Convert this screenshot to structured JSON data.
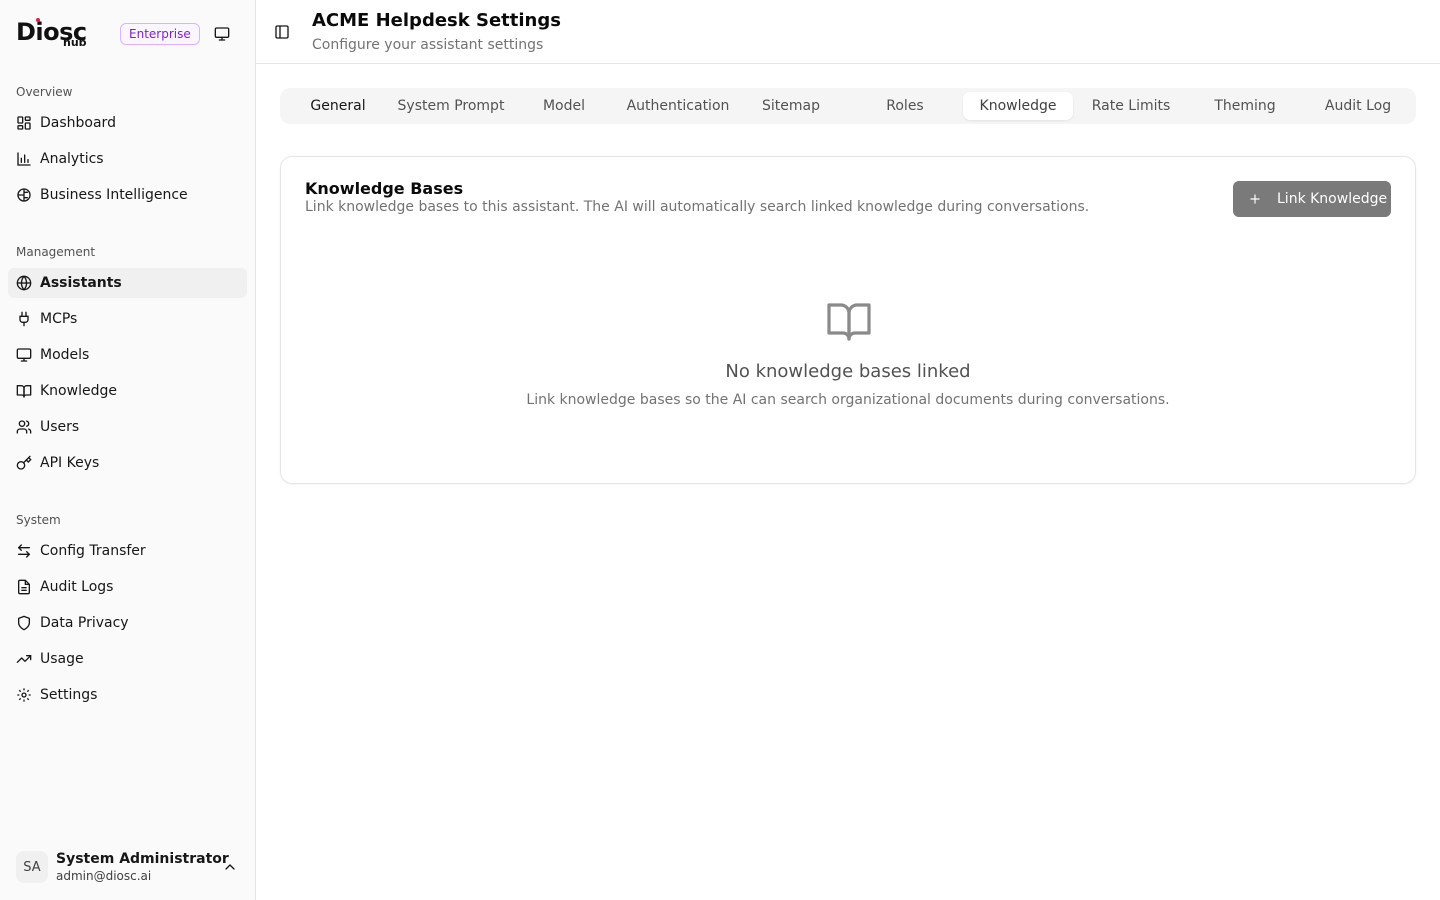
{
  "brand": {
    "logo_text": "Diosc",
    "logo_sub": "hub",
    "plan_badge": "Enterprise",
    "accent_color": "#7e22ce"
  },
  "sidebar": {
    "sections": [
      {
        "label": "Overview",
        "items": [
          {
            "label": "Dashboard",
            "icon": "dashboard-icon"
          },
          {
            "label": "Analytics",
            "icon": "bar-chart-icon"
          },
          {
            "label": "Business Intelligence",
            "icon": "brain-icon"
          }
        ]
      },
      {
        "label": "Management",
        "items": [
          {
            "label": "Assistants",
            "icon": "globe-icon",
            "active": true
          },
          {
            "label": "MCPs",
            "icon": "plug-icon"
          },
          {
            "label": "Models",
            "icon": "monitor-icon"
          },
          {
            "label": "Knowledge",
            "icon": "book-icon"
          },
          {
            "label": "Users",
            "icon": "users-icon"
          },
          {
            "label": "API Keys",
            "icon": "key-icon"
          }
        ]
      },
      {
        "label": "System",
        "items": [
          {
            "label": "Config Transfer",
            "icon": "transfer-icon"
          },
          {
            "label": "Audit Logs",
            "icon": "file-text-icon"
          },
          {
            "label": "Data Privacy",
            "icon": "shield-icon"
          },
          {
            "label": "Usage",
            "icon": "trending-icon"
          },
          {
            "label": "Settings",
            "icon": "gear-icon"
          }
        ]
      }
    ],
    "user": {
      "initials": "SA",
      "name": "System Administrator",
      "email": "admin@diosc.ai"
    }
  },
  "header": {
    "title": "ACME Helpdesk Settings",
    "subtitle": "Configure your assistant settings"
  },
  "tabs": [
    {
      "label": "General"
    },
    {
      "label": "System Prompt"
    },
    {
      "label": "Model"
    },
    {
      "label": "Authentication"
    },
    {
      "label": "Sitemap"
    },
    {
      "label": "Roles"
    },
    {
      "label": "Knowledge",
      "active": true
    },
    {
      "label": "Rate Limits"
    },
    {
      "label": "Theming"
    },
    {
      "label": "Audit Log"
    }
  ],
  "knowledge_card": {
    "title": "Knowledge Bases",
    "description": "Link knowledge bases to this assistant. The AI will automatically search linked knowledge during conversations.",
    "link_button": "Link Knowledge",
    "empty_title": "No knowledge bases linked",
    "empty_description": "Link knowledge bases so the AI can search organizational documents during conversations."
  }
}
